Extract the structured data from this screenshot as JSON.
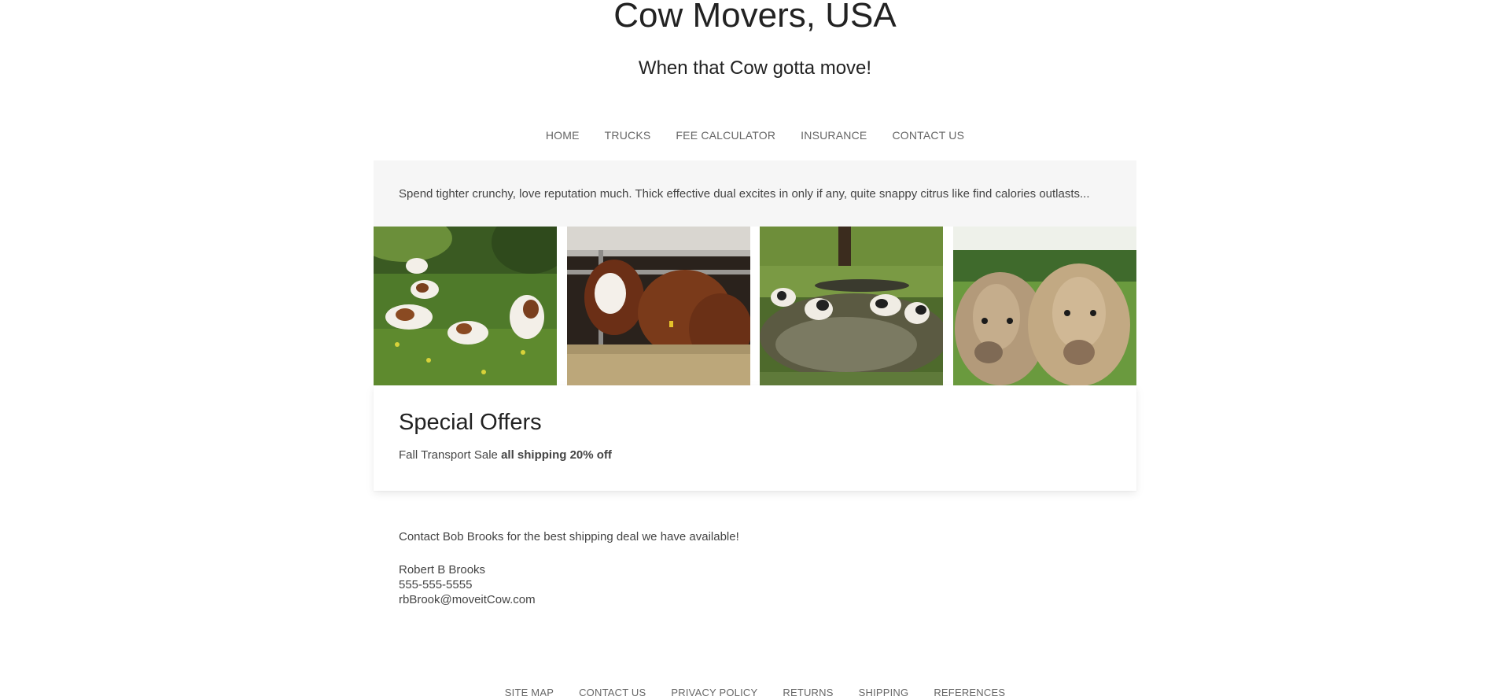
{
  "header": {
    "title": "Cow Movers, USA",
    "tagline": "When that Cow gotta move!"
  },
  "nav": {
    "items": [
      {
        "label": "HOME"
      },
      {
        "label": "TRUCKS"
      },
      {
        "label": "FEE CALCULATOR"
      },
      {
        "label": "INSURANCE"
      },
      {
        "label": "CONTACT US"
      }
    ]
  },
  "intro": {
    "text": "Spend tighter crunchy, love reputation much. Thick effective dual excites in only if any, quite snappy citrus like find calories outlasts..."
  },
  "gallery": {
    "photos": [
      {
        "subject": "brown-and-white cows resting in green meadow"
      },
      {
        "subject": "hereford cattle eating hay behind fence"
      },
      {
        "subject": "holstein cows crossing a stream"
      },
      {
        "subject": "two tan cows in a pasture"
      }
    ]
  },
  "offers": {
    "heading": "Special Offers",
    "text": "Fall Transport Sale",
    "highlight": "all shipping 20% off"
  },
  "contact": {
    "lead": "Contact Bob Brooks for the best shipping deal we have available!",
    "name": "Robert B Brooks",
    "phone": "555-555-5555",
    "email": "rbBrook@moveitCow.com"
  },
  "footer": {
    "items": [
      {
        "label": "SITE MAP"
      },
      {
        "label": "CONTACT US"
      },
      {
        "label": "PRIVACY POLICY"
      },
      {
        "label": "RETURNS"
      },
      {
        "label": "SHIPPING"
      },
      {
        "label": "REFERENCES"
      }
    ]
  }
}
